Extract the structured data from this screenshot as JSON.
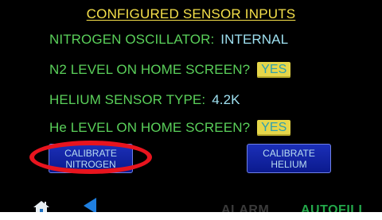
{
  "screen": {
    "title": "CONFIGURED SENSOR INPUTS",
    "nitrogen_oscillator": {
      "label": "NITROGEN OSCILLATOR:",
      "value": "INTERNAL"
    },
    "n2_level_home": {
      "label": "N2 LEVEL ON HOME SCREEN?",
      "button": "YES"
    },
    "helium_sensor_type": {
      "label": "HELIUM SENSOR TYPE:",
      "value": "4.2K"
    },
    "he_level_home": {
      "label": "He LEVEL ON HOME SCREEN?",
      "button": "YES"
    },
    "calibrate_nitrogen": {
      "line1": "CALIBRATE",
      "line2": "NITROGEN"
    },
    "calibrate_helium": {
      "line1": "CALIBRATE",
      "line2": "HELIUM"
    }
  },
  "footer": {
    "home_icon": "home-icon",
    "back_icon": "back-arrow-icon",
    "alarm": "ALARM",
    "autofill": "AUTOFILL"
  },
  "colors": {
    "background": "#000000",
    "title": "#f5e04a",
    "label": "#5ad05a",
    "value": "#9ee0f0",
    "yes_button": "#e6d64a",
    "calibrate_button": "#1b2fb8",
    "highlight_ring": "#e8141e",
    "autofill": "#23a84a"
  }
}
